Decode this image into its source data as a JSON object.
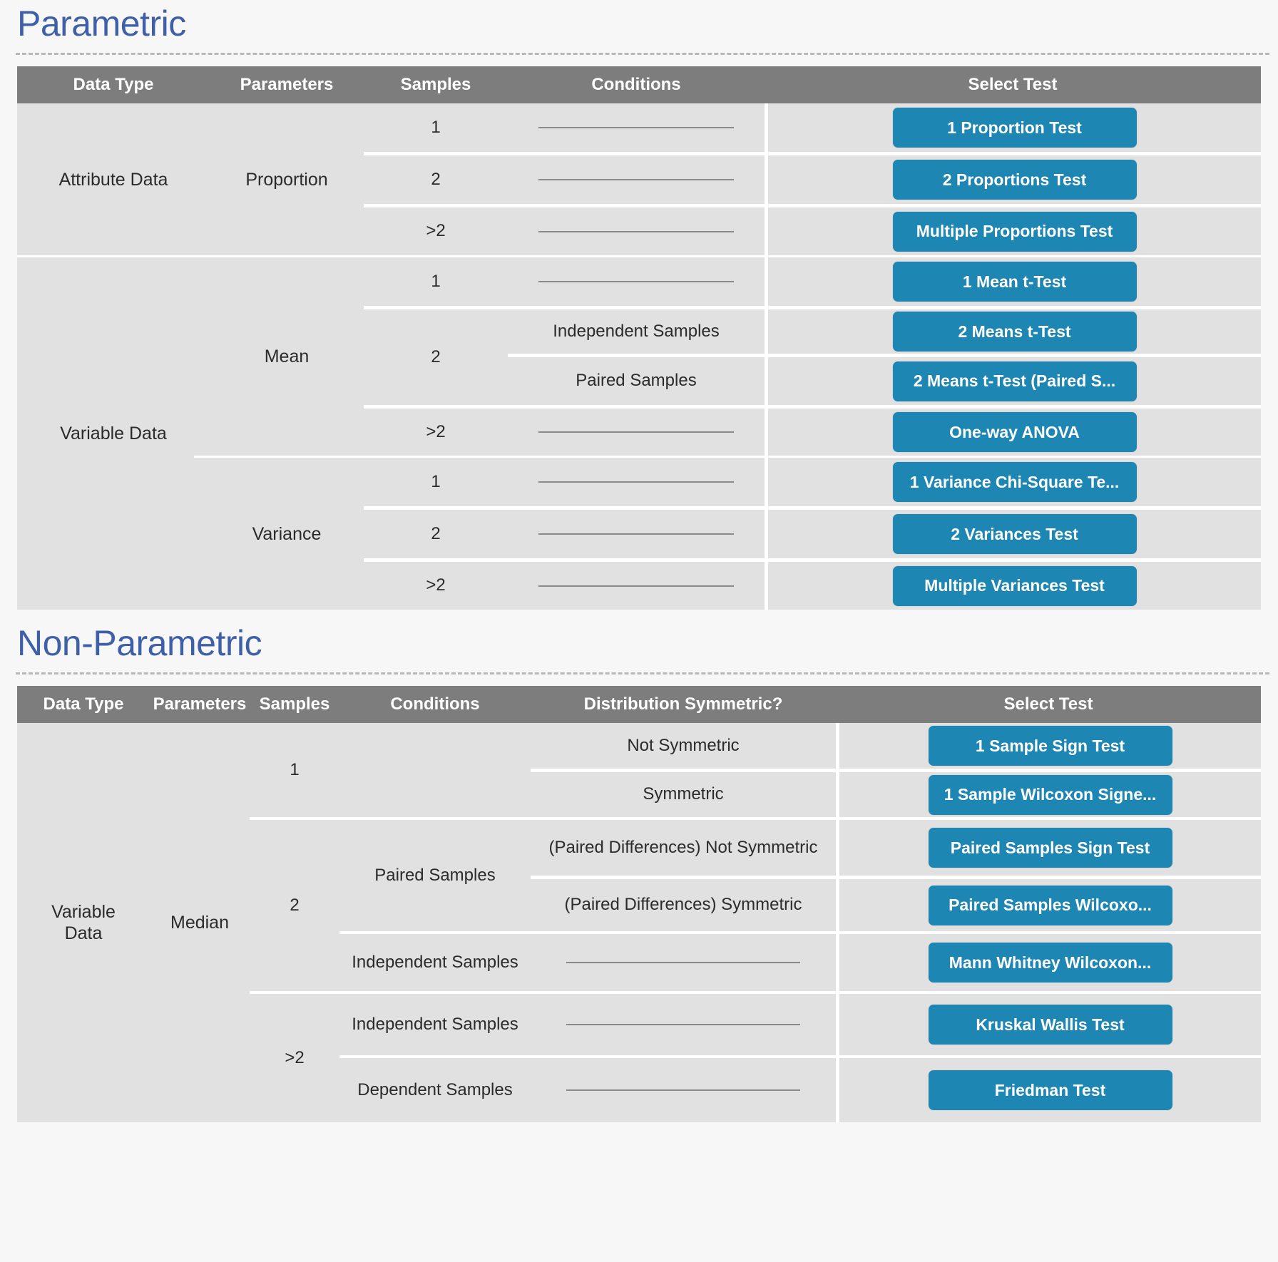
{
  "sections": [
    {
      "title": "Parametric",
      "columns": [
        "Data Type",
        "Parameters",
        "Samples",
        "Conditions",
        "Select Test"
      ],
      "rows": [
        {
          "data_type": "Attribute Data",
          "parameter": "Proportion",
          "samples": "1",
          "conditions": "",
          "test": "1 Proportion Test"
        },
        {
          "data_type": "Attribute Data",
          "parameter": "Proportion",
          "samples": "2",
          "conditions": "",
          "test": "2 Proportions Test"
        },
        {
          "data_type": "Attribute Data",
          "parameter": "Proportion",
          "samples": ">2",
          "conditions": "",
          "test": "Multiple Proportions Test"
        },
        {
          "data_type": "Variable Data",
          "parameter": "Mean",
          "samples": "1",
          "conditions": "",
          "test": "1 Mean t-Test"
        },
        {
          "data_type": "Variable Data",
          "parameter": "Mean",
          "samples": "2",
          "conditions": "Independent Samples",
          "test": "2 Means t-Test"
        },
        {
          "data_type": "Variable Data",
          "parameter": "Mean",
          "samples": "2",
          "conditions": "Paired Samples",
          "test": "2 Means t-Test (Paired S..."
        },
        {
          "data_type": "Variable Data",
          "parameter": "Mean",
          "samples": ">2",
          "conditions": "",
          "test": "One-way ANOVA"
        },
        {
          "data_type": "Variable Data",
          "parameter": "Variance",
          "samples": "1",
          "conditions": "",
          "test": "1 Variance Chi-Square Te..."
        },
        {
          "data_type": "Variable Data",
          "parameter": "Variance",
          "samples": "2",
          "conditions": "",
          "test": "2 Variances Test"
        },
        {
          "data_type": "Variable Data",
          "parameter": "Variance",
          "samples": ">2",
          "conditions": "",
          "test": "Multiple Variances Test"
        }
      ]
    },
    {
      "title": "Non-Parametric",
      "columns": [
        "Data Type",
        "Parameters",
        "Samples",
        "Conditions",
        "Distribution Symmetric?",
        "Select Test"
      ],
      "rows": [
        {
          "data_type": "Variable Data",
          "parameter": "Median",
          "samples": "1",
          "conditions": "",
          "symmetry": "Not Symmetric",
          "test": "1 Sample Sign Test"
        },
        {
          "data_type": "Variable Data",
          "parameter": "Median",
          "samples": "1",
          "conditions": "",
          "symmetry": "Symmetric",
          "test": "1 Sample Wilcoxon Signe..."
        },
        {
          "data_type": "Variable Data",
          "parameter": "Median",
          "samples": "2",
          "conditions": "Paired Samples",
          "symmetry": "(Paired Differences) Not Symmetric",
          "test": "Paired Samples Sign Test"
        },
        {
          "data_type": "Variable Data",
          "parameter": "Median",
          "samples": "2",
          "conditions": "Paired Samples",
          "symmetry": "(Paired Differences) Symmetric",
          "test": "Paired Samples Wilcoxo..."
        },
        {
          "data_type": "Variable Data",
          "parameter": "Median",
          "samples": "2",
          "conditions": "Independent Samples",
          "symmetry": "",
          "test": "Mann Whitney Wilcoxon..."
        },
        {
          "data_type": "Variable Data",
          "parameter": "Median",
          "samples": ">2",
          "conditions": "Independent Samples",
          "symmetry": "",
          "test": "Kruskal Wallis Test"
        },
        {
          "data_type": "Variable Data",
          "parameter": "Median",
          "samples": ">2",
          "conditions": "Dependent Samples",
          "symmetry": "",
          "test": "Friedman Test"
        }
      ],
      "group_labels": {
        "data_type": "Variable\nData",
        "parameter": "Median"
      }
    }
  ],
  "colors": {
    "header_bg": "#7d7d7d",
    "row_bg": "#e1e1e1",
    "button_bg": "#1d86b3",
    "title_text": "#3f5fa8",
    "page_bg": "#f7f7f7"
  }
}
